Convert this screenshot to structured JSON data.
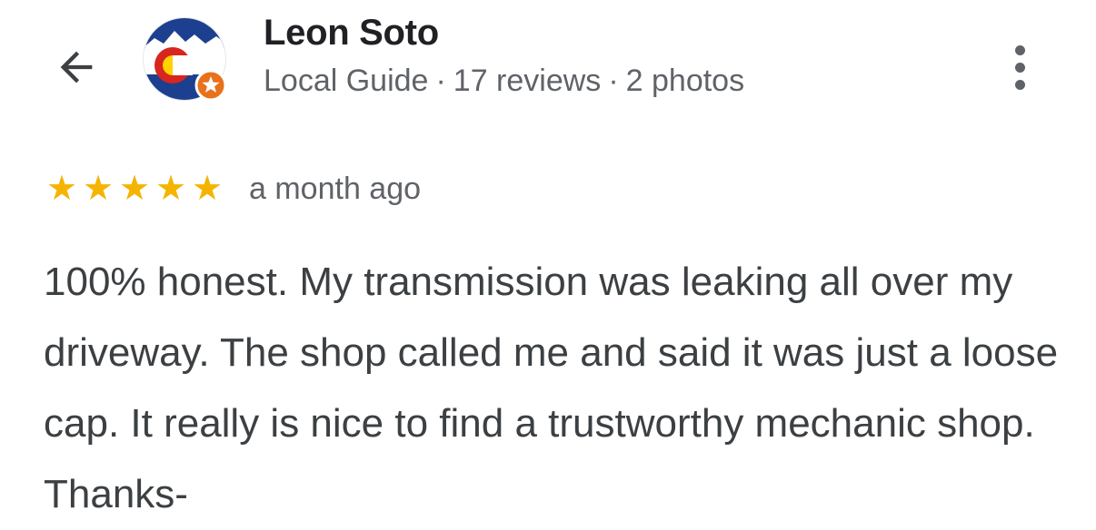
{
  "reviewer": {
    "name": "Leon Soto",
    "badge": "Local Guide",
    "separator": "·",
    "reviews": "17 reviews",
    "photos": "2 photos"
  },
  "icons": {
    "back": "arrow-left-icon",
    "more": "more-vert-icon",
    "local_guide_badge": "star-badge-icon"
  },
  "review": {
    "rating": 5,
    "rating_max": 5,
    "time": "a month ago",
    "text": "100% honest. My transmission was leaking all over my driveway. The shop called me and said it was just a loose cap. It really is nice to find a trustworthy mechanic shop. Thanks-"
  },
  "colors": {
    "star": "#f4b400",
    "name": "#202124",
    "secondary": "#5f6368",
    "body": "#3c4043",
    "badge": "#e8711c"
  }
}
